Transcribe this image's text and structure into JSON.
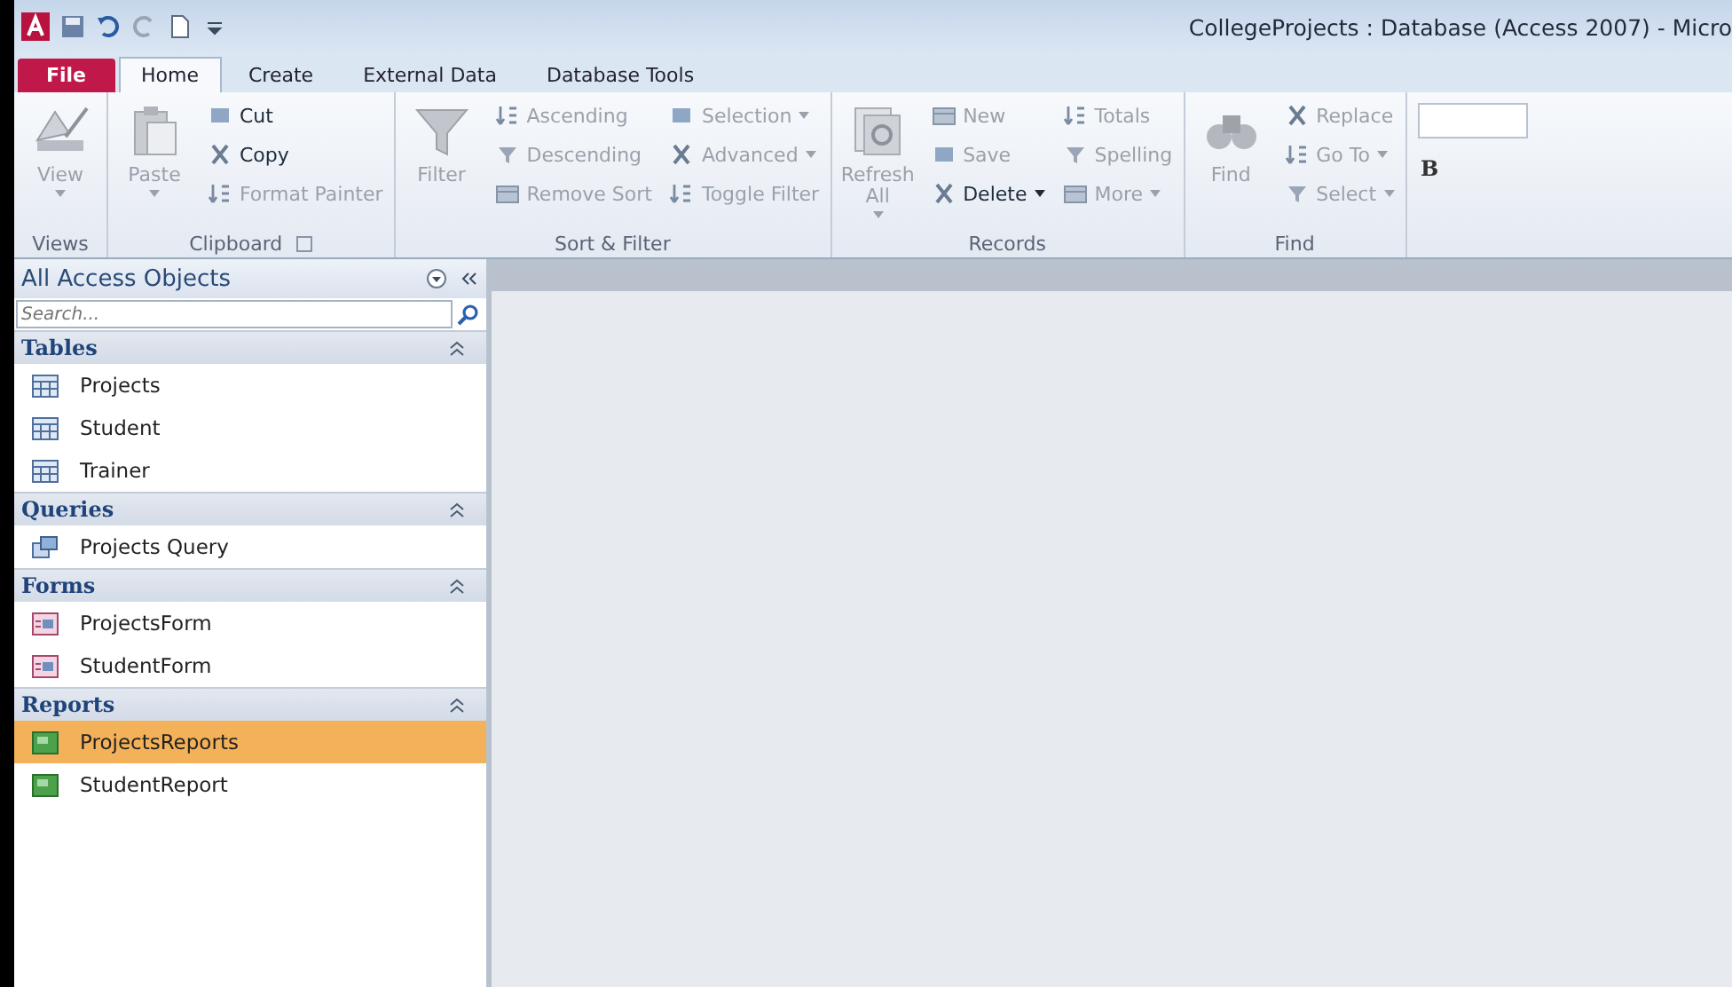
{
  "window": {
    "title": "CollegeProjects : Database (Access 2007) - Micro"
  },
  "tabs": [
    {
      "label": "File",
      "kind": "file",
      "selected": false
    },
    {
      "label": "Home",
      "kind": "tab",
      "selected": true
    },
    {
      "label": "Create",
      "kind": "tab",
      "selected": false
    },
    {
      "label": "External Data",
      "kind": "tab",
      "selected": false
    },
    {
      "label": "Database Tools",
      "kind": "tab",
      "selected": false
    }
  ],
  "ribbon": {
    "groups": [
      {
        "label": "Views",
        "launcher": false,
        "columns": [
          {
            "kind": "large",
            "label": "View",
            "dropdown": true,
            "disabled": true
          }
        ]
      },
      {
        "label": "Clipboard",
        "launcher": true,
        "columns": [
          {
            "kind": "large",
            "label": "Paste",
            "dropdown": true,
            "disabled": true
          },
          {
            "kind": "small",
            "items": [
              {
                "label": "Cut",
                "dropdown": false,
                "disabled": false
              },
              {
                "label": "Copy",
                "dropdown": false,
                "disabled": false
              },
              {
                "label": "Format Painter",
                "dropdown": false,
                "disabled": true
              }
            ]
          }
        ]
      },
      {
        "label": "Sort & Filter",
        "launcher": false,
        "columns": [
          {
            "kind": "large",
            "label": "Filter",
            "dropdown": false,
            "disabled": true
          },
          {
            "kind": "small",
            "items": [
              {
                "label": "Ascending",
                "dropdown": false,
                "disabled": true
              },
              {
                "label": "Descending",
                "dropdown": false,
                "disabled": true
              },
              {
                "label": "Remove Sort",
                "dropdown": false,
                "disabled": true
              }
            ]
          },
          {
            "kind": "small",
            "items": [
              {
                "label": "Selection",
                "dropdown": true,
                "disabled": true
              },
              {
                "label": "Advanced",
                "dropdown": true,
                "disabled": true
              },
              {
                "label": "Toggle Filter",
                "dropdown": false,
                "disabled": true
              }
            ]
          }
        ]
      },
      {
        "label": "Records",
        "launcher": false,
        "columns": [
          {
            "kind": "large",
            "label": "Refresh All",
            "dropdown": true,
            "disabled": true
          },
          {
            "kind": "small",
            "items": [
              {
                "label": "New",
                "dropdown": false,
                "disabled": true
              },
              {
                "label": "Save",
                "dropdown": false,
                "disabled": true
              },
              {
                "label": "Delete",
                "dropdown": true,
                "disabled": false
              }
            ]
          },
          {
            "kind": "small",
            "items": [
              {
                "label": "Totals",
                "dropdown": false,
                "disabled": true
              },
              {
                "label": "Spelling",
                "dropdown": false,
                "disabled": true
              },
              {
                "label": "More",
                "dropdown": true,
                "disabled": true
              }
            ]
          }
        ]
      },
      {
        "label": "Find",
        "launcher": false,
        "columns": [
          {
            "kind": "large",
            "label": "Find",
            "dropdown": false,
            "disabled": true
          },
          {
            "kind": "small",
            "items": [
              {
                "label": "Replace",
                "dropdown": false,
                "disabled": true
              },
              {
                "label": "Go To",
                "dropdown": true,
                "disabled": true
              },
              {
                "label": "Select",
                "dropdown": true,
                "disabled": true
              }
            ]
          }
        ]
      }
    ],
    "font_partial": {
      "bold": "B"
    }
  },
  "navigation": {
    "title": "All Access Objects",
    "search": {
      "placeholder": "Search..."
    },
    "groups": [
      {
        "name": "Tables",
        "kind": "table",
        "expanded": true,
        "items": [
          {
            "label": "Projects",
            "selected": false
          },
          {
            "label": "Student",
            "selected": false
          },
          {
            "label": "Trainer",
            "selected": false
          }
        ]
      },
      {
        "name": "Queries",
        "kind": "query",
        "expanded": true,
        "items": [
          {
            "label": "Projects Query",
            "selected": false
          }
        ]
      },
      {
        "name": "Forms",
        "kind": "form",
        "expanded": true,
        "items": [
          {
            "label": "ProjectsForm",
            "selected": false
          },
          {
            "label": "StudentForm",
            "selected": false
          }
        ]
      },
      {
        "name": "Reports",
        "kind": "report",
        "expanded": true,
        "items": [
          {
            "label": "ProjectsReports",
            "selected": true
          },
          {
            "label": "StudentReport",
            "selected": false
          }
        ]
      }
    ]
  }
}
